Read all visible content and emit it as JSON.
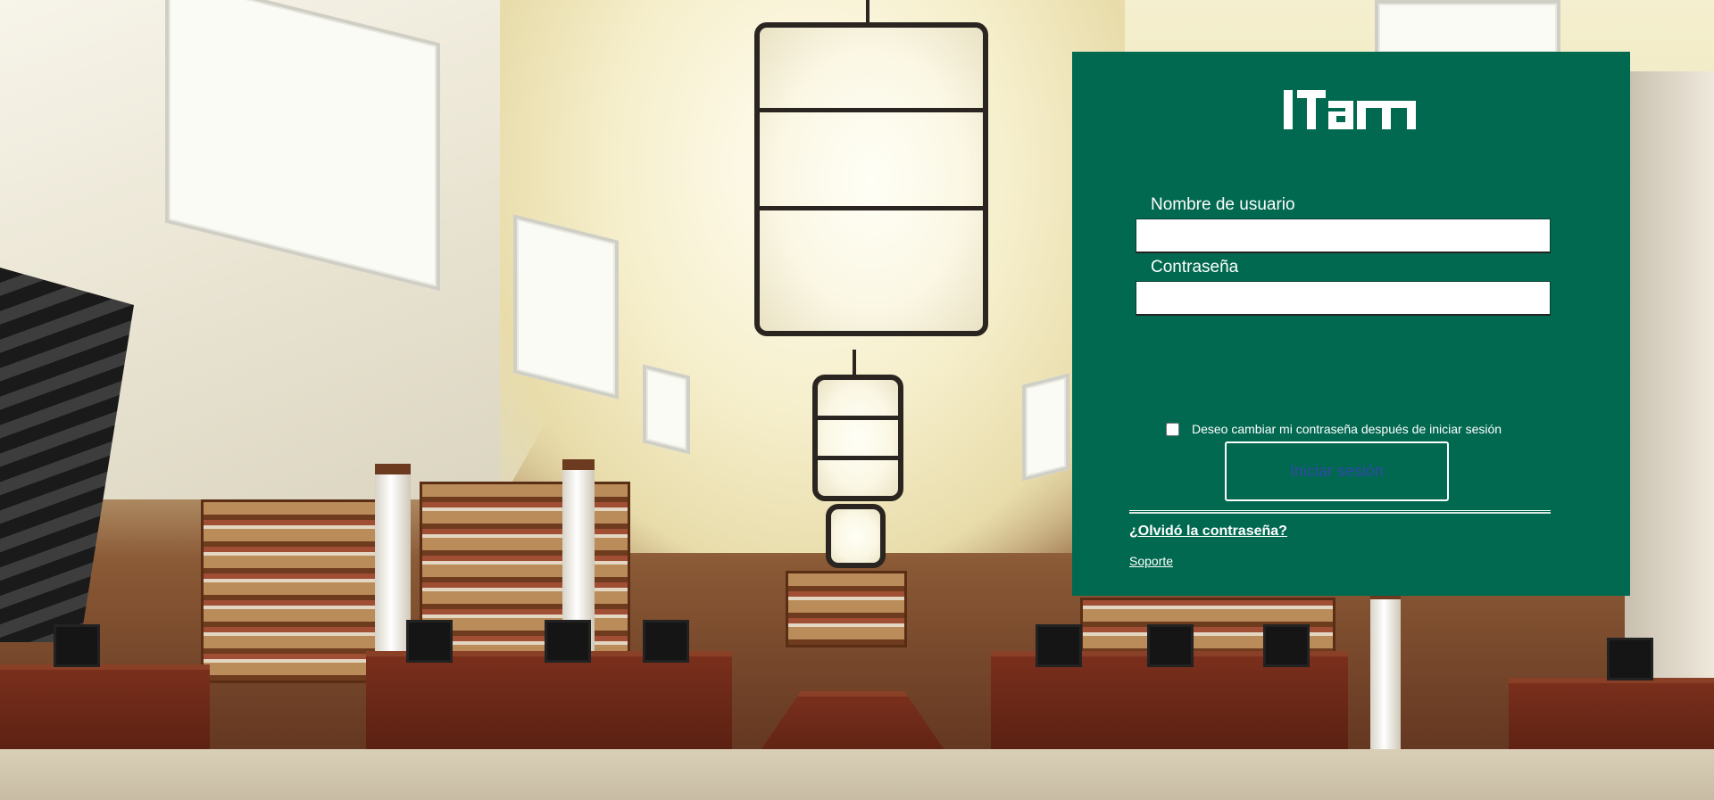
{
  "logo": {
    "text": "ITAM"
  },
  "login": {
    "username_label": "Nombre de usuario",
    "username_value": "",
    "password_label": "Contraseña",
    "password_value": "",
    "change_password_label": "Deseo cambiar mi contraseña después de iniciar sesión",
    "change_password_checked": false,
    "submit_label": "Iniciar sesión",
    "forgot_password_link": "¿Olvidó la contraseña?",
    "support_link": "Soporte"
  },
  "colors": {
    "panel_background": "#016950",
    "submit_text": "#3248a8",
    "text": "#ffffff"
  }
}
